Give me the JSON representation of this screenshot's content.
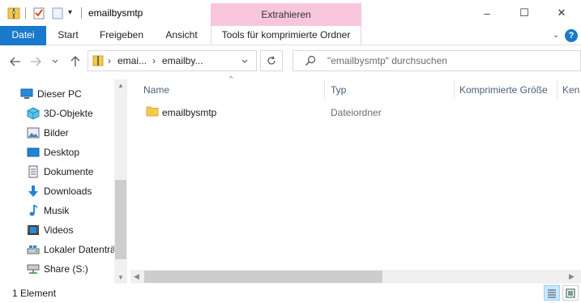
{
  "window": {
    "title": "emailbysmtp",
    "context_group": "Extrahieren",
    "controls": {
      "minimize": "–",
      "maximize": "☐",
      "close": "✕"
    }
  },
  "ribbon": {
    "tabs": [
      "Datei",
      "Start",
      "Freigeben",
      "Ansicht",
      "Tools für komprimierte Ordner"
    ]
  },
  "address": {
    "parts": [
      "emai...",
      "emailby..."
    ],
    "search_placeholder": "\"emailbysmtp\" durchsuchen"
  },
  "nav": {
    "items": [
      {
        "label": "Dieser PC",
        "icon": "pc-icon"
      },
      {
        "label": "3D-Objekte",
        "icon": "3d-objects-icon"
      },
      {
        "label": "Bilder",
        "icon": "pictures-icon"
      },
      {
        "label": "Desktop",
        "icon": "desktop-icon"
      },
      {
        "label": "Dokumente",
        "icon": "documents-icon"
      },
      {
        "label": "Downloads",
        "icon": "download-arrow-icon"
      },
      {
        "label": "Musik",
        "icon": "music-note-icon"
      },
      {
        "label": "Videos",
        "icon": "video-film-icon"
      },
      {
        "label": "Lokaler Datenträ",
        "icon": "local-drive-icon"
      },
      {
        "label": "Share (S:)",
        "icon": "network-drive-icon"
      }
    ]
  },
  "columns": [
    "Name",
    "Typ",
    "Komprimierte Größe",
    "Ken"
  ],
  "files": [
    {
      "name": "emailbysmtp",
      "type": "Dateiordner"
    }
  ],
  "status": {
    "count": "1 Element"
  },
  "colors": {
    "file_tab": "#1979ca",
    "context_group": "#f7c6dc",
    "header_text": "#4c607a",
    "folder": "#f3c94e"
  }
}
